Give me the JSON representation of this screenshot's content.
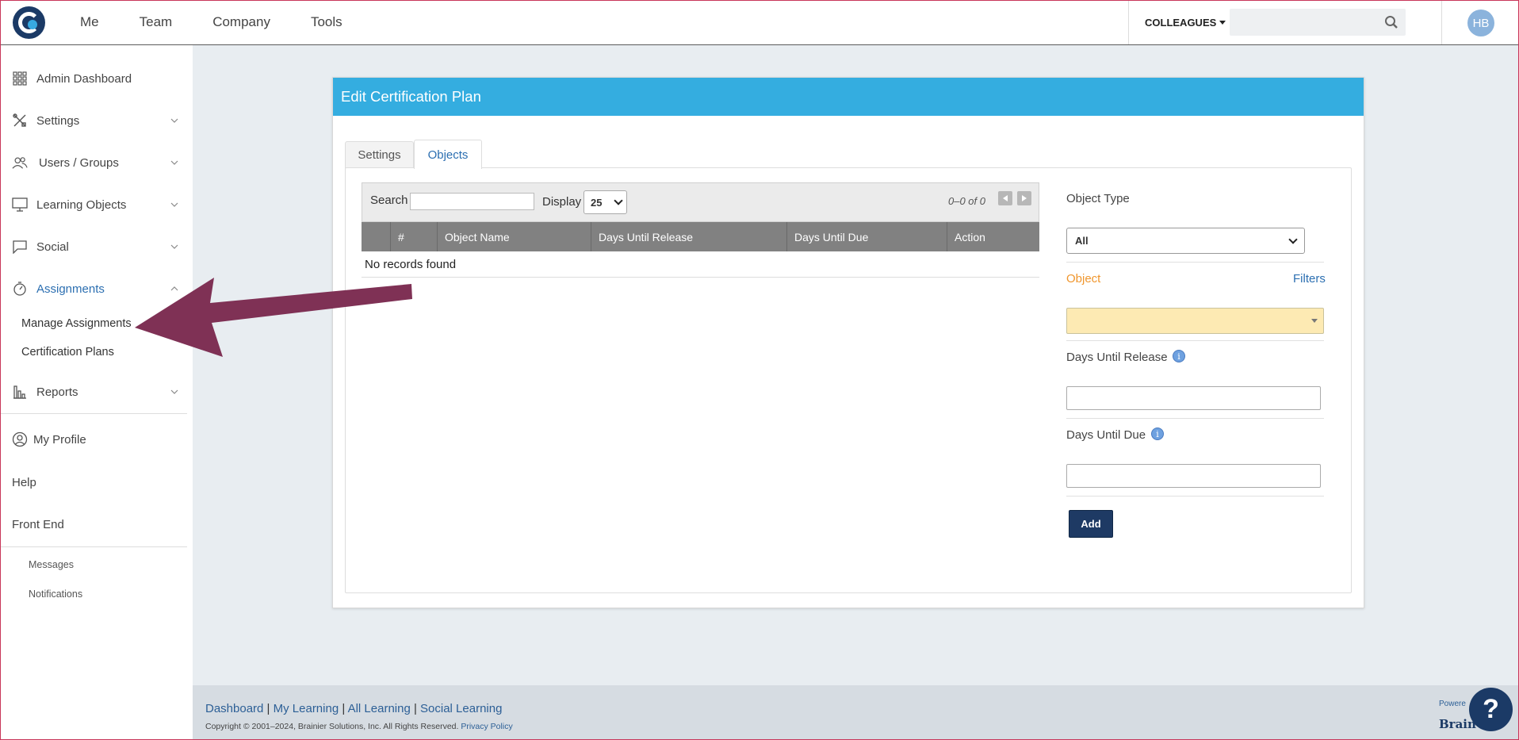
{
  "topnav": {
    "links": [
      "Me",
      "Team",
      "Company",
      "Tools"
    ],
    "colleagues_label": "COLLEAGUES",
    "search_placeholder": "",
    "avatar_initials": "HB"
  },
  "sidebar": {
    "items": [
      {
        "label": "Admin Dashboard",
        "icon": "grid-icon"
      },
      {
        "label": "Settings",
        "icon": "tools-icon"
      },
      {
        "label": "Users / Groups",
        "icon": "users-icon"
      },
      {
        "label": "Learning Objects",
        "icon": "monitor-icon"
      },
      {
        "label": "Social",
        "icon": "chat-icon"
      },
      {
        "label": "Assignments",
        "icon": "stopwatch-icon"
      },
      {
        "label": "Reports",
        "icon": "bar-chart-icon"
      }
    ],
    "assignments_sub": [
      "Manage Assignments",
      "Certification Plans"
    ],
    "profile_label": "My Profile",
    "help_label": "Help",
    "frontend_label": "Front End",
    "messages_label": "Messages",
    "notifications_label": "Notifications"
  },
  "card": {
    "title": "Edit Certification Plan",
    "tabs": [
      "Settings",
      "Objects"
    ],
    "active_tab": "Objects"
  },
  "table": {
    "search_label": "Search",
    "search_value": "",
    "display_label": "Display",
    "display_value": "25",
    "pager_text": "0–0 of 0",
    "columns": [
      "",
      "#",
      "Object Name",
      "Days Until Release",
      "Days Until Due",
      "Action"
    ],
    "empty_text": "No records found"
  },
  "form": {
    "object_type_label": "Object Type",
    "object_type_value": "All",
    "object_label": "Object",
    "filters_label": "Filters",
    "days_release_label": "Days Until Release",
    "days_due_label": "Days Until Due",
    "add_label": "Add"
  },
  "footer": {
    "links": [
      "Dashboard",
      "My Learning",
      "All Learning",
      "Social Learning"
    ],
    "copyright": "Copyright © 2001–2024, Brainier Solutions, Inc. All Rights Reserved.",
    "privacy": "Privacy Policy",
    "powered": "Powere",
    "brand": "Brain"
  },
  "help_fab": "?",
  "colors": {
    "header_blue": "#34ade0",
    "navy": "#1e3a64",
    "accent_link": "#2c6fb1",
    "object_orange": "#f0962d",
    "arrow": "#7f3155"
  }
}
